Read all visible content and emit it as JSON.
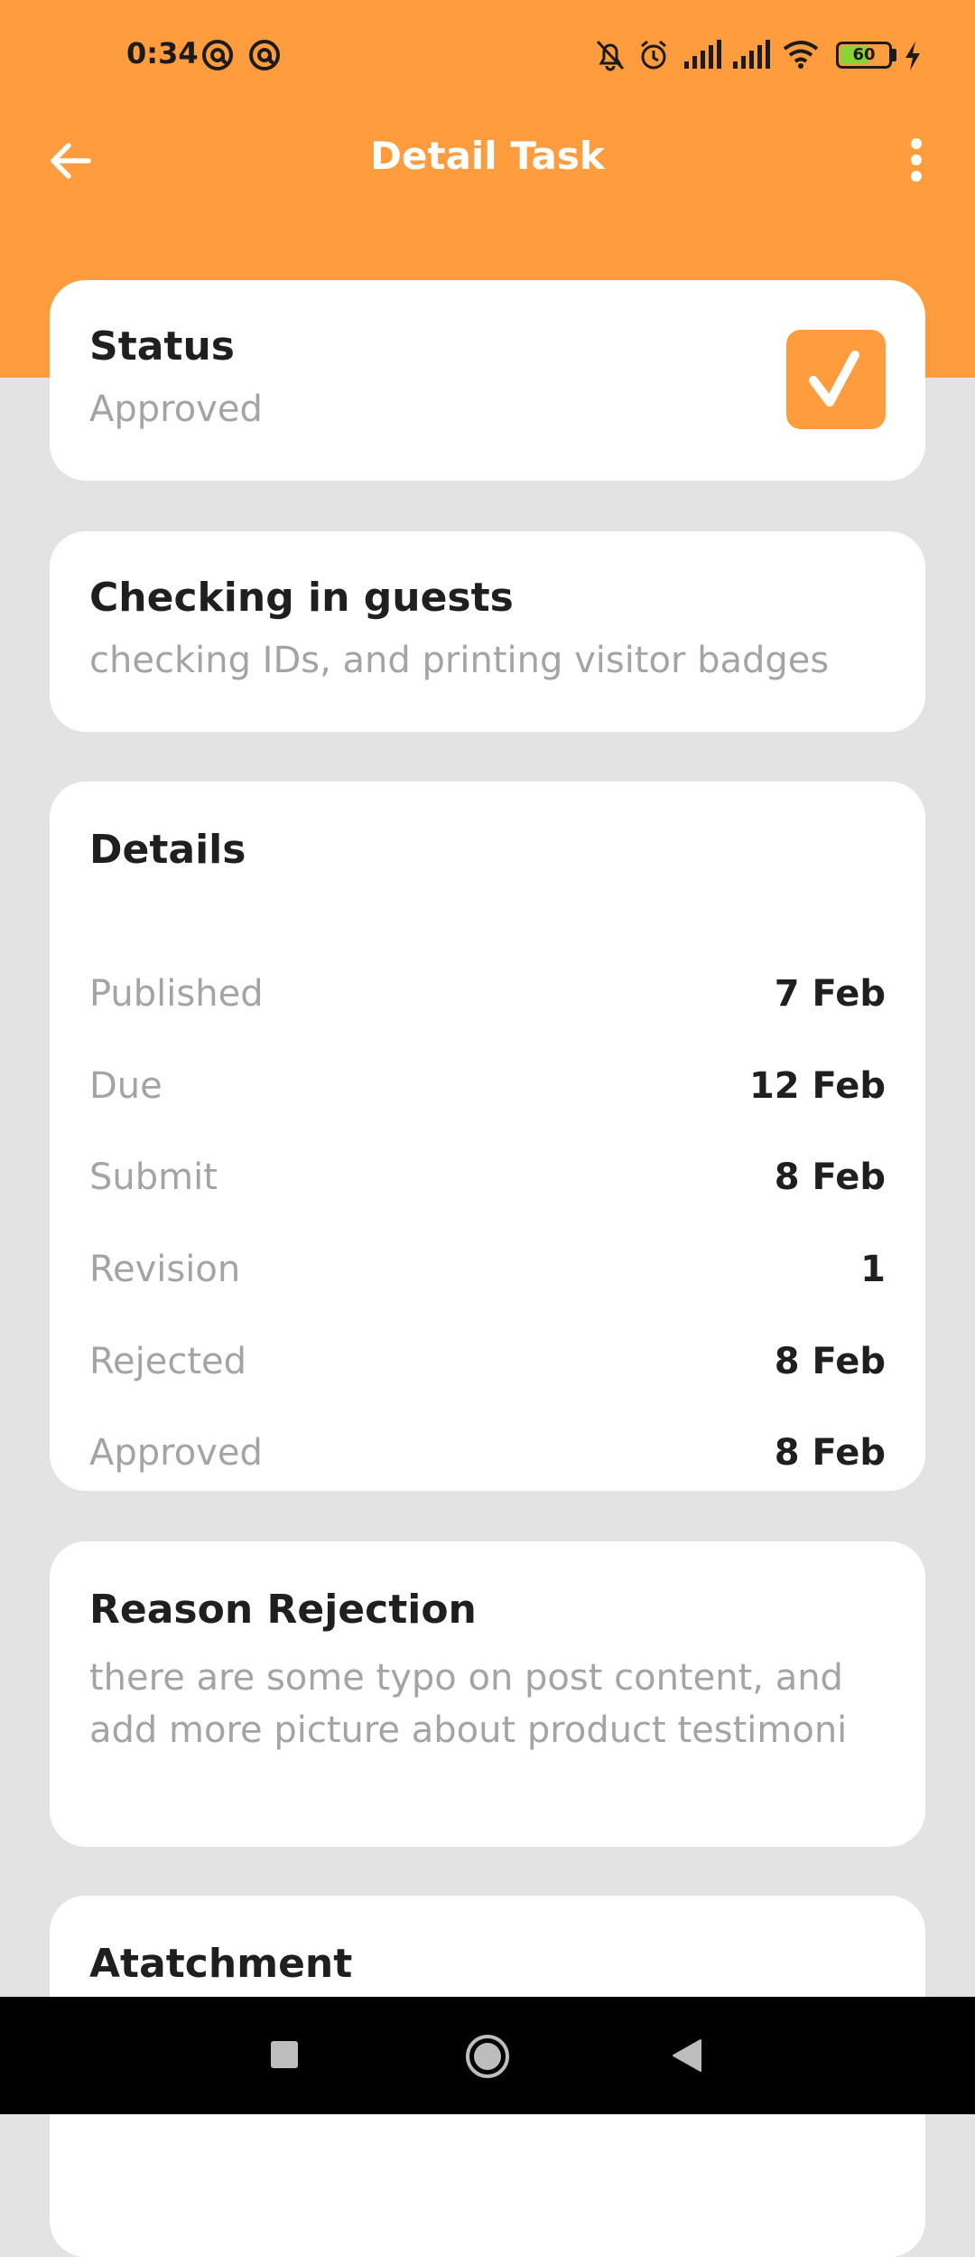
{
  "status_bar": {
    "time": "0:34",
    "battery_level": "60",
    "battery_fraction": 0.6
  },
  "app_bar": {
    "title": "Detail Task"
  },
  "status_card": {
    "title": "Status",
    "value": "Approved"
  },
  "task_card": {
    "title": "Checking in guests",
    "description": "checking IDs, and printing visitor badges"
  },
  "details_card": {
    "title": "Details",
    "rows": [
      {
        "label": "Published",
        "value": "7 Feb"
      },
      {
        "label": "Due",
        "value": "12 Feb"
      },
      {
        "label": "Submit",
        "value": "8 Feb"
      },
      {
        "label": "Revision",
        "value": "1"
      },
      {
        "label": "Rejected",
        "value": "8 Feb"
      },
      {
        "label": "Approved",
        "value": "8 Feb"
      }
    ]
  },
  "reason_card": {
    "title": "Reason Rejection",
    "text": "there are some typo on post content, and add more picture about product testimoni"
  },
  "attachment_card": {
    "title": "Atatchment"
  },
  "colors": {
    "accent": "#fe9c3e",
    "background": "#e3e3e3",
    "card": "#ffffff",
    "secondary_text": "#a4a4a4",
    "battery": "#8bd235"
  }
}
